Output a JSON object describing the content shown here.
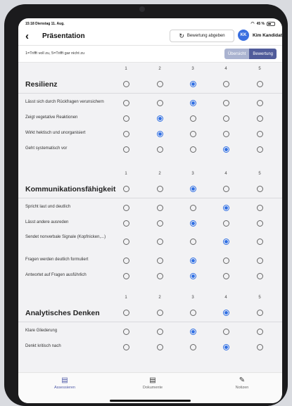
{
  "status": {
    "time_date": "15:18  Dienstag 11. Aug.",
    "battery": "45 %"
  },
  "nav": {
    "back_icon": "chevron-left-icon",
    "title": "Präsentation",
    "submit_label": "Bewertung abgeben",
    "user_initials": "KK",
    "user_name": "Kim Kandidat"
  },
  "scale": {
    "hint": "1=Trifft voll zu, 5=Trifft gar nicht zu",
    "tabs": [
      {
        "label": "Übersicht",
        "active": false
      },
      {
        "label": "Bewertung",
        "active": true
      }
    ]
  },
  "sections": [
    {
      "title": "Resilienz",
      "numbers": [
        "1",
        "2",
        "3",
        "4",
        "5"
      ],
      "header_selected": 3,
      "items": [
        {
          "label": "Lässt sich durch Rückfragen verunsichern",
          "selected": 3
        },
        {
          "label": "Zeigt vegetative Reaktionen",
          "selected": 2
        },
        {
          "label": "Wirkt hektisch und unorganisiert",
          "selected": 2
        },
        {
          "label": "Geht systematisch vor",
          "selected": 4
        }
      ]
    },
    {
      "title": "Kommunikationsfähigkeit",
      "numbers": [
        "1",
        "2",
        "3",
        "4",
        "5"
      ],
      "header_selected": 3,
      "items": [
        {
          "label": "Spricht laut und deutlich",
          "selected": 4
        },
        {
          "label": "Lässt andere ausreden",
          "selected": 3
        },
        {
          "label": "Sendet nonverbale Signale (Kopfnicken,...)",
          "selected": 4
        },
        {
          "label": "Fragen werden deutlich formuliert",
          "selected": 3
        },
        {
          "label": "Antwortet auf Fragen ausführlich",
          "selected": 3
        }
      ]
    },
    {
      "title": "Analytisches Denken",
      "numbers": [
        "1",
        "2",
        "3",
        "4",
        "5"
      ],
      "header_selected": 4,
      "items": [
        {
          "label": "Klare Gliederung",
          "selected": 3
        },
        {
          "label": "Denkt kritisch nach",
          "selected": 4
        }
      ]
    }
  ],
  "tabbar": [
    {
      "label": "Assessieren",
      "icon": "clipboard-icon",
      "active": true
    },
    {
      "label": "Dokumente",
      "icon": "document-icon",
      "active": false
    },
    {
      "label": "Notizen",
      "icon": "pencil-icon",
      "active": false
    }
  ],
  "colors": {
    "accent": "#2f6fe4",
    "segment_active": "#505b9a",
    "segment_inactive": "#aab3d0",
    "tab_active": "#4f5aa8"
  }
}
